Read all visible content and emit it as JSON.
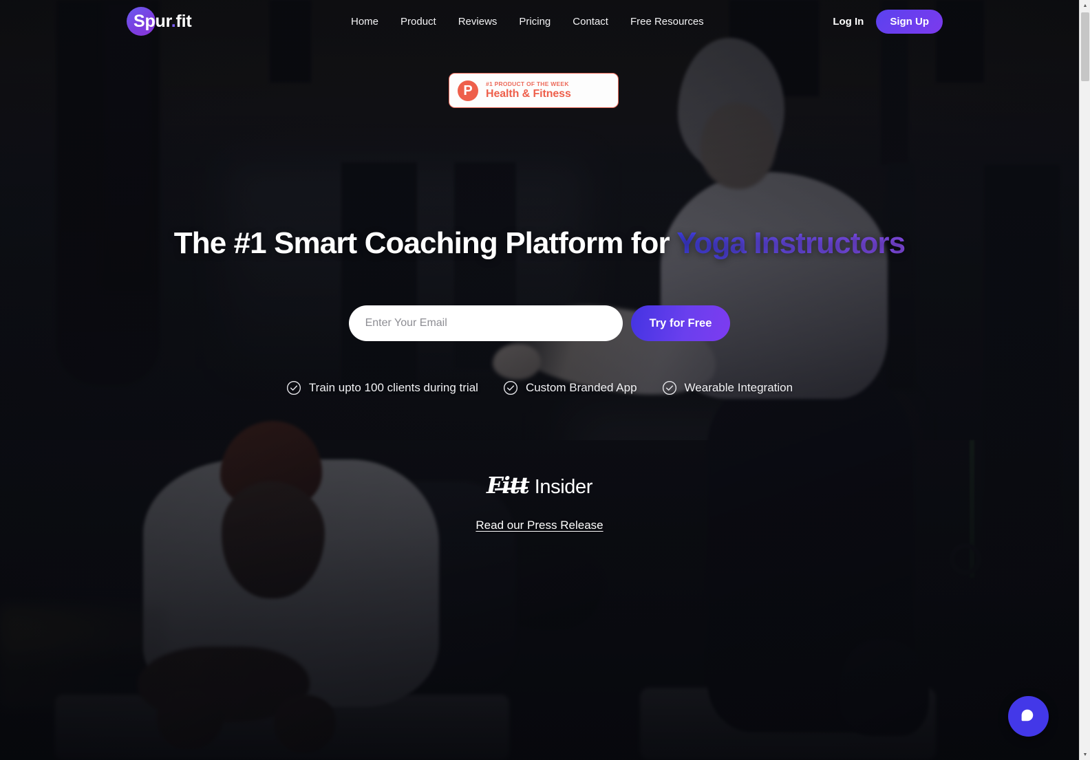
{
  "brand": {
    "name": "Spur.fit",
    "name_main": "Spur",
    "name_dot": ".",
    "name_suffix": "fit"
  },
  "nav": {
    "links": [
      {
        "label": "Home"
      },
      {
        "label": "Product"
      },
      {
        "label": "Reviews"
      },
      {
        "label": "Pricing"
      },
      {
        "label": "Contact"
      },
      {
        "label": "Free Resources"
      }
    ],
    "login_label": "Log In",
    "signup_label": "Sign Up",
    "signup_color": "#6b3aee"
  },
  "badge": {
    "icon": "product-hunt-p",
    "icon_letter": "P",
    "kicker": "#1 PRODUCT OF THE WEEK",
    "title": "Health & Fitness",
    "accent_color": "#ee5f4b"
  },
  "hero": {
    "headline_prefix": "The #1 Smart Coaching Platform for ",
    "headline_accent": "Yoga Instructors",
    "accent_color": "#5b45ef",
    "email_placeholder": "Enter Your Email",
    "email_value": "",
    "cta_label": "Try for Free",
    "cta_color": "#5b3aee",
    "features": [
      {
        "label": "Train upto 100 clients during trial",
        "icon": "check-circle-icon"
      },
      {
        "label": "Custom Branded App",
        "icon": "check-circle-icon"
      },
      {
        "label": "Wearable Integration",
        "icon": "check-circle-icon"
      }
    ]
  },
  "press": {
    "logo_script": "Fitt",
    "logo_regular": "Insider",
    "link_label": "Read our Press Release"
  },
  "chat": {
    "icon": "chat-bubble-icon",
    "color": "#4338e8"
  },
  "scrollbar": {
    "up_arrow": "▲",
    "down_arrow": "▼"
  }
}
